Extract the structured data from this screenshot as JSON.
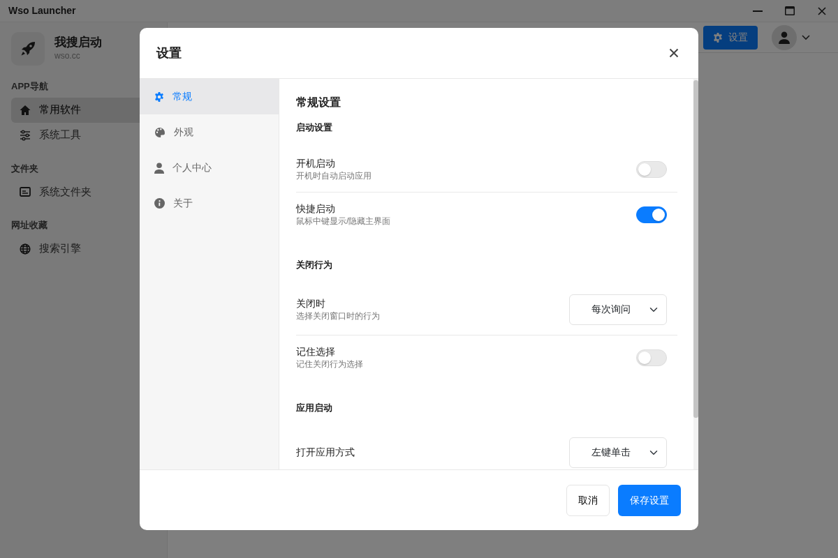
{
  "window": {
    "title": "Wso Launcher"
  },
  "app": {
    "name": "我搜启动",
    "domain": "wso.cc"
  },
  "sidebar": {
    "groups": [
      {
        "title": "APP导航",
        "items": [
          {
            "label": "常用软件",
            "selected": true
          },
          {
            "label": "系统工具",
            "selected": false
          }
        ]
      },
      {
        "title": "文件夹",
        "items": [
          {
            "label": "系统文件夹",
            "selected": false
          }
        ]
      },
      {
        "title": "网址收藏",
        "items": [
          {
            "label": "搜索引擎",
            "selected": false
          }
        ]
      }
    ]
  },
  "topbar": {
    "settings_button": "设置"
  },
  "dialog": {
    "title": "设置",
    "nav": [
      {
        "label": "常规",
        "selected": true
      },
      {
        "label": "外观",
        "selected": false
      },
      {
        "label": "个人中心",
        "selected": false
      },
      {
        "label": "关于",
        "selected": false
      }
    ],
    "content_title": "常规设置",
    "sections": [
      {
        "title": "启动设置",
        "items": [
          {
            "kind": "toggle",
            "label": "开机启动",
            "description": "开机时自动启动应用",
            "on": false
          },
          {
            "kind": "toggle",
            "label": "快捷启动",
            "description": "鼠标中键显示/隐藏主界面",
            "on": true
          }
        ]
      },
      {
        "title": "关闭行为",
        "items": [
          {
            "kind": "select",
            "label": "关闭时",
            "description": "选择关闭窗口时的行为",
            "value": "每次询问"
          },
          {
            "kind": "toggle",
            "label": "记住选择",
            "description": "记住关闭行为选择",
            "on": false
          }
        ]
      },
      {
        "title": "应用启动",
        "items": [
          {
            "kind": "select",
            "label": "打开应用方式",
            "value": "左键单击"
          }
        ]
      }
    ],
    "buttons": [
      {
        "label": "取消",
        "kind": "secondary"
      },
      {
        "label": "保存设置",
        "kind": "primary"
      }
    ]
  }
}
